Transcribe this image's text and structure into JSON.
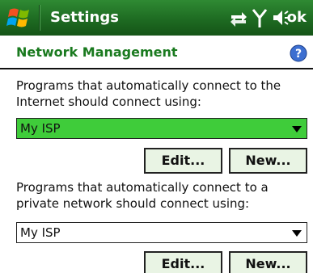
{
  "title_bar": {
    "title": "Settings",
    "ok_label": "ok",
    "icons": [
      "windows-start-icon",
      "connectivity-icon",
      "signal-icon",
      "volume-icon"
    ]
  },
  "header": {
    "title": "Network Management",
    "help_icon": "help-icon"
  },
  "internet": {
    "description": "Programs that automatically connect to the Internet should connect using:",
    "selected": "My ISP",
    "edit_label": "Edit...",
    "new_label": "New..."
  },
  "private": {
    "description": "Programs that automatically connect to a private network should connect using:",
    "selected": "My ISP",
    "edit_label": "Edit...",
    "new_label": "New..."
  },
  "colors": {
    "title_bar": "#1e6b22",
    "accent_text": "#1a7a1f",
    "selected_dropdown": "#3fcc3a",
    "button_bg": "#e9f4e4"
  }
}
